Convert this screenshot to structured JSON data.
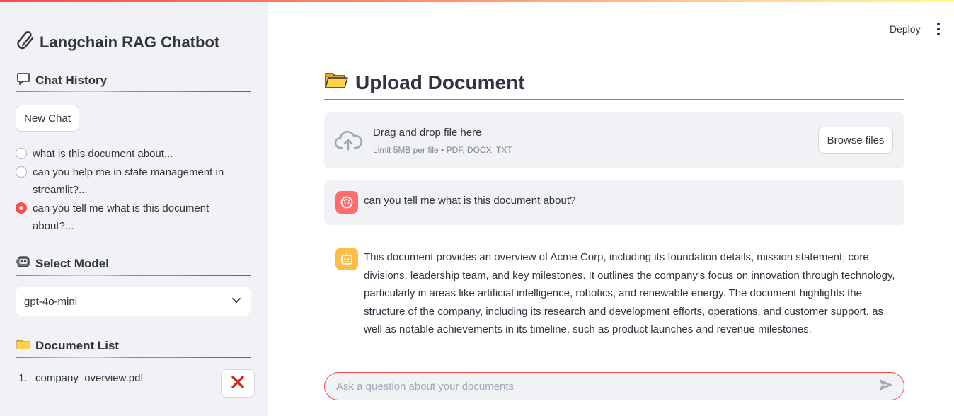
{
  "sidebar": {
    "title": "Langchain RAG Chatbot",
    "chat_history": {
      "heading": "Chat History",
      "new_chat_label": "New Chat",
      "items": [
        {
          "label": "what is this document about...",
          "selected": false
        },
        {
          "label": "can you help me in state management in streamlit?...",
          "selected": false
        },
        {
          "label": "can you tell me what is this document about?...",
          "selected": true
        }
      ]
    },
    "select_model": {
      "heading": "Select Model",
      "selected_value": "gpt-4o-mini"
    },
    "document_list": {
      "heading": "Document List",
      "items": [
        {
          "number": "1.",
          "name": "company_overview.pdf"
        }
      ]
    }
  },
  "header": {
    "deploy_label": "Deploy"
  },
  "main": {
    "title": "Upload Document",
    "uploader": {
      "drop_text": "Drag and drop file here",
      "limit_text": "Limit 5MB per file • PDF, DOCX, TXT",
      "browse_label": "Browse files"
    },
    "messages": [
      {
        "role": "user",
        "text": "can you tell me what is this document about?"
      },
      {
        "role": "assistant",
        "text": "This document provides an overview of Acme Corp, including its foundation details, mission statement, core divisions, leadership team, and key milestones. It outlines the company's focus on innovation through technology, particularly in areas like artificial intelligence, robotics, and renewable energy. The document highlights the structure of the company, including its research and development efforts, operations, and customer support, as well as notable achievements in its timeline, such as product launches and revenue milestones."
      }
    ],
    "chat_input": {
      "placeholder": "Ask a question about your documents",
      "value": ""
    }
  },
  "colors": {
    "accent": "#ff4b4b",
    "sidebar_bg": "#f0f2f6",
    "title_rule": "#1c83e1",
    "user_avatar": "#ff6c6c",
    "assistant_avatar": "#ffbd45"
  },
  "icons": {
    "app_logo": "paperclip-icon",
    "chat_history": "speech-bubble-icon",
    "select_model": "robot-face-icon",
    "document_list": "folder-icon",
    "upload_title": "open-folder-icon",
    "uploader": "cloud-upload-icon",
    "delete": "red-x-icon",
    "send": "send-arrow-icon"
  }
}
